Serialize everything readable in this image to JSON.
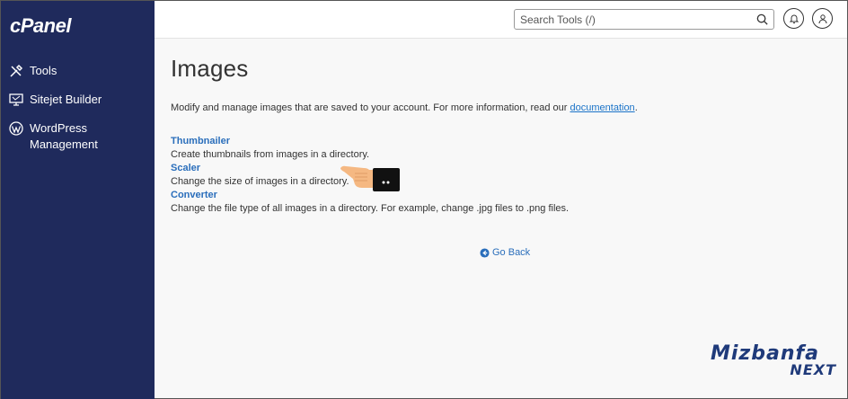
{
  "sidebar": {
    "logo": "cPanel",
    "items": [
      {
        "label": "Tools",
        "icon": "tools-icon"
      },
      {
        "label": "Sitejet Builder",
        "icon": "monitor-icon"
      },
      {
        "label": "WordPress Management",
        "icon": "wordpress-icon"
      }
    ]
  },
  "header": {
    "search_placeholder": "Search Tools (/)",
    "icons": [
      "bell-icon",
      "user-icon"
    ]
  },
  "main": {
    "title": "Images",
    "description": "Modify and manage images that are saved to your account. For more information, read our ",
    "doc_link": "documentation",
    "doc_suffix": ".",
    "tools": [
      {
        "name": "Thumbnailer",
        "desc": "Create thumbnails from images in a directory."
      },
      {
        "name": "Scaler",
        "desc": "Change the size of images in a directory."
      },
      {
        "name": "Converter",
        "desc": "Change the file type of all images in a directory. For example, change .jpg files to .png files."
      }
    ],
    "go_back": "Go Back"
  },
  "watermark": {
    "top": "Mizbanfa",
    "bottom": "NEXT"
  },
  "colors": {
    "sidebar_bg": "#1f2a5c",
    "link": "#2a6ebb",
    "watermark": "#1f3a7a"
  }
}
